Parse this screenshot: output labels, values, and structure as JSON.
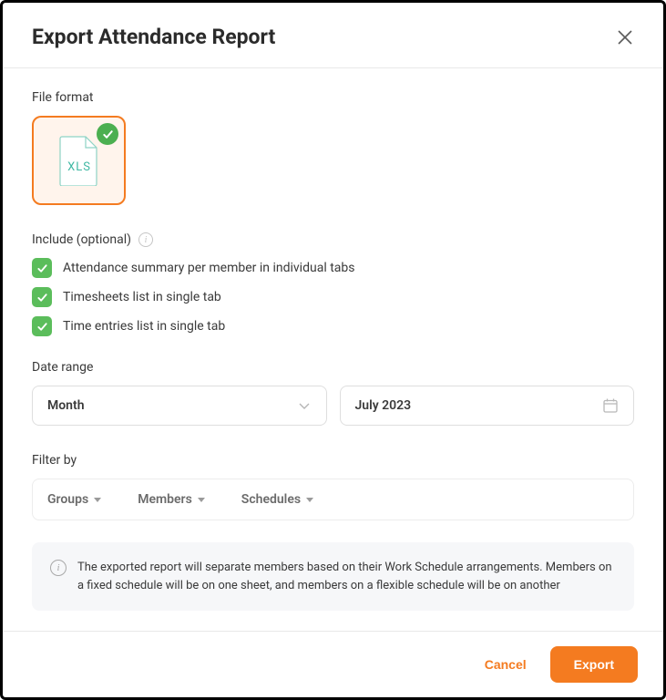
{
  "header": {
    "title": "Export Attendance Report"
  },
  "file_format": {
    "label": "File format",
    "selected": "XLS"
  },
  "include": {
    "label": "Include (optional)",
    "items": [
      {
        "label": "Attendance summary per member in individual tabs",
        "checked": true
      },
      {
        "label": "Timesheets list in single tab",
        "checked": true
      },
      {
        "label": "Time entries list in single tab",
        "checked": true
      }
    ]
  },
  "date_range": {
    "label": "Date range",
    "period_type": "Month",
    "period_value": "July 2023"
  },
  "filter": {
    "label": "Filter by",
    "items": [
      {
        "label": "Groups"
      },
      {
        "label": "Members"
      },
      {
        "label": "Schedules"
      }
    ]
  },
  "info": {
    "text": "The exported report will separate members based on their Work Schedule arrangements. Members on a fixed schedule will be on one sheet, and members on a flexible schedule will be on another"
  },
  "footer": {
    "cancel": "Cancel",
    "export": "Export"
  }
}
